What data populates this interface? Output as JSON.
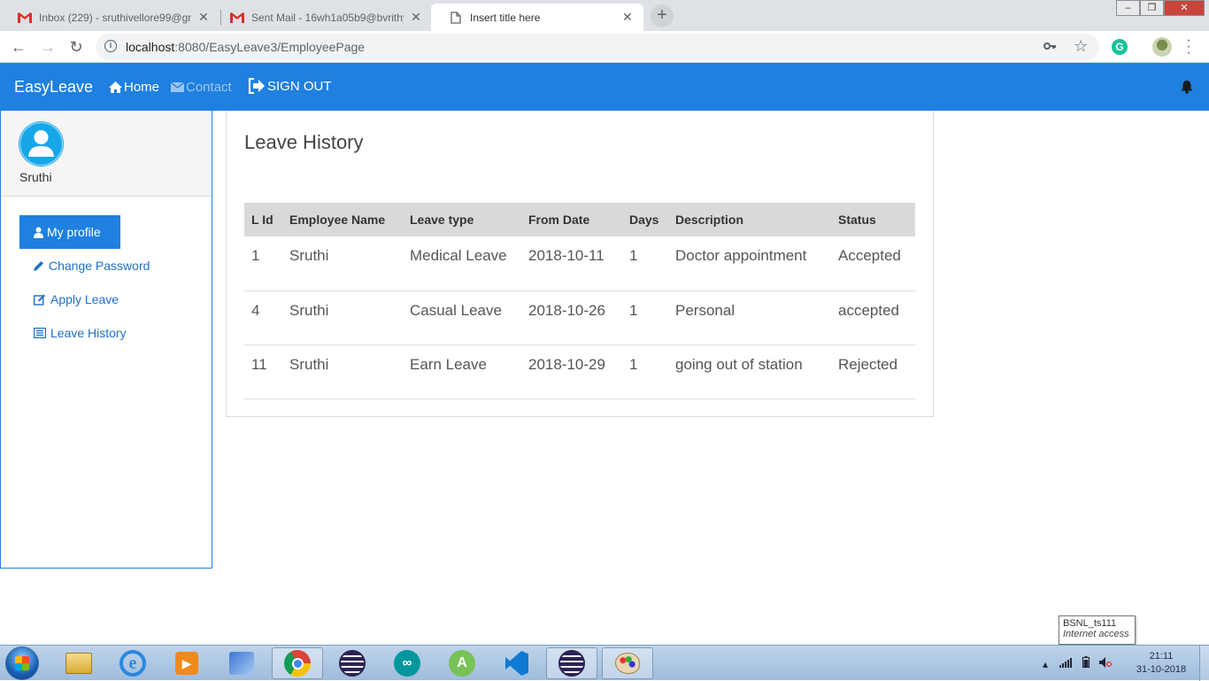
{
  "browser": {
    "tabs": [
      {
        "label": "Inbox (229) - sruthivellore99@gm",
        "icon": "gmail-icon",
        "active": false
      },
      {
        "label": "Sent Mail - 16wh1a05b9@bvrithy",
        "icon": "gmail-icon",
        "active": false
      },
      {
        "label": "Insert title here",
        "icon": "page-icon",
        "active": true
      }
    ],
    "new_tab": "+",
    "url_host": "localhost",
    "url_rest": ":8080/EasyLeave3/EmployeePage",
    "info_icon": "i",
    "window_controls": {
      "minimize": "–",
      "maximize": "❐",
      "close": "✕"
    }
  },
  "app": {
    "brand": "EasyLeave",
    "nav": {
      "home": "Home",
      "contact": "Contact",
      "signout": "SIGN OUT"
    },
    "accent": "#1f80e0"
  },
  "sidebar": {
    "user_name": "Sruthi",
    "primary_button": "My profile",
    "links": [
      "Change Password",
      "Apply Leave",
      "Leave History"
    ]
  },
  "main": {
    "title": "Leave History",
    "columns": [
      "L Id",
      "Employee Name",
      "Leave type",
      "From Date",
      "Days",
      "Description",
      "Status"
    ],
    "rows": [
      [
        "1",
        "Sruthi",
        "Medical Leave",
        "2018-10-11",
        "1",
        "Doctor appointment",
        "Accepted"
      ],
      [
        "4",
        "Sruthi",
        "Casual Leave",
        "2018-10-26",
        "1",
        "Personal",
        "accepted"
      ],
      [
        "11",
        "Sruthi",
        "Earn Leave",
        "2018-10-29",
        "1",
        "going out of station",
        "Rejected"
      ]
    ]
  },
  "tooltip": {
    "network": "BSNL_ts111",
    "status": "Internet access"
  },
  "taskbar": {
    "time": "21:11",
    "date": "31-10-2018"
  }
}
